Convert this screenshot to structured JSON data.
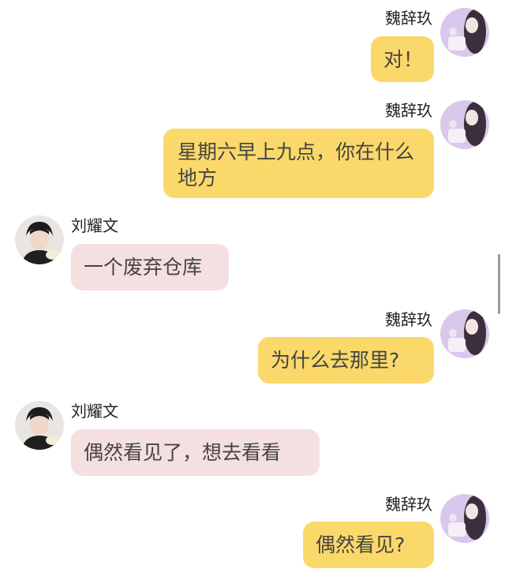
{
  "messages": [
    {
      "side": "right",
      "sender": "魏辞玖",
      "text": "对！",
      "avatar": "girl-avatar"
    },
    {
      "side": "right",
      "sender": "魏辞玖",
      "text": "星期六早上九点，你在什么地方",
      "avatar": "girl-avatar"
    },
    {
      "side": "left",
      "sender": "刘耀文",
      "text": "一个废弃仓库",
      "avatar": "boy-avatar"
    },
    {
      "side": "right",
      "sender": "魏辞玖",
      "text": "为什么去那里?",
      "avatar": "girl-avatar"
    },
    {
      "side": "left",
      "sender": "刘耀文",
      "text": "偶然看见了，想去看看",
      "avatar": "boy-avatar"
    },
    {
      "side": "right",
      "sender": "魏辞玖",
      "text": "偶然看见?",
      "avatar": "girl-avatar"
    }
  ],
  "colors": {
    "right_bubble": "#fbd86a",
    "left_bubble": "#f4dfe1"
  }
}
